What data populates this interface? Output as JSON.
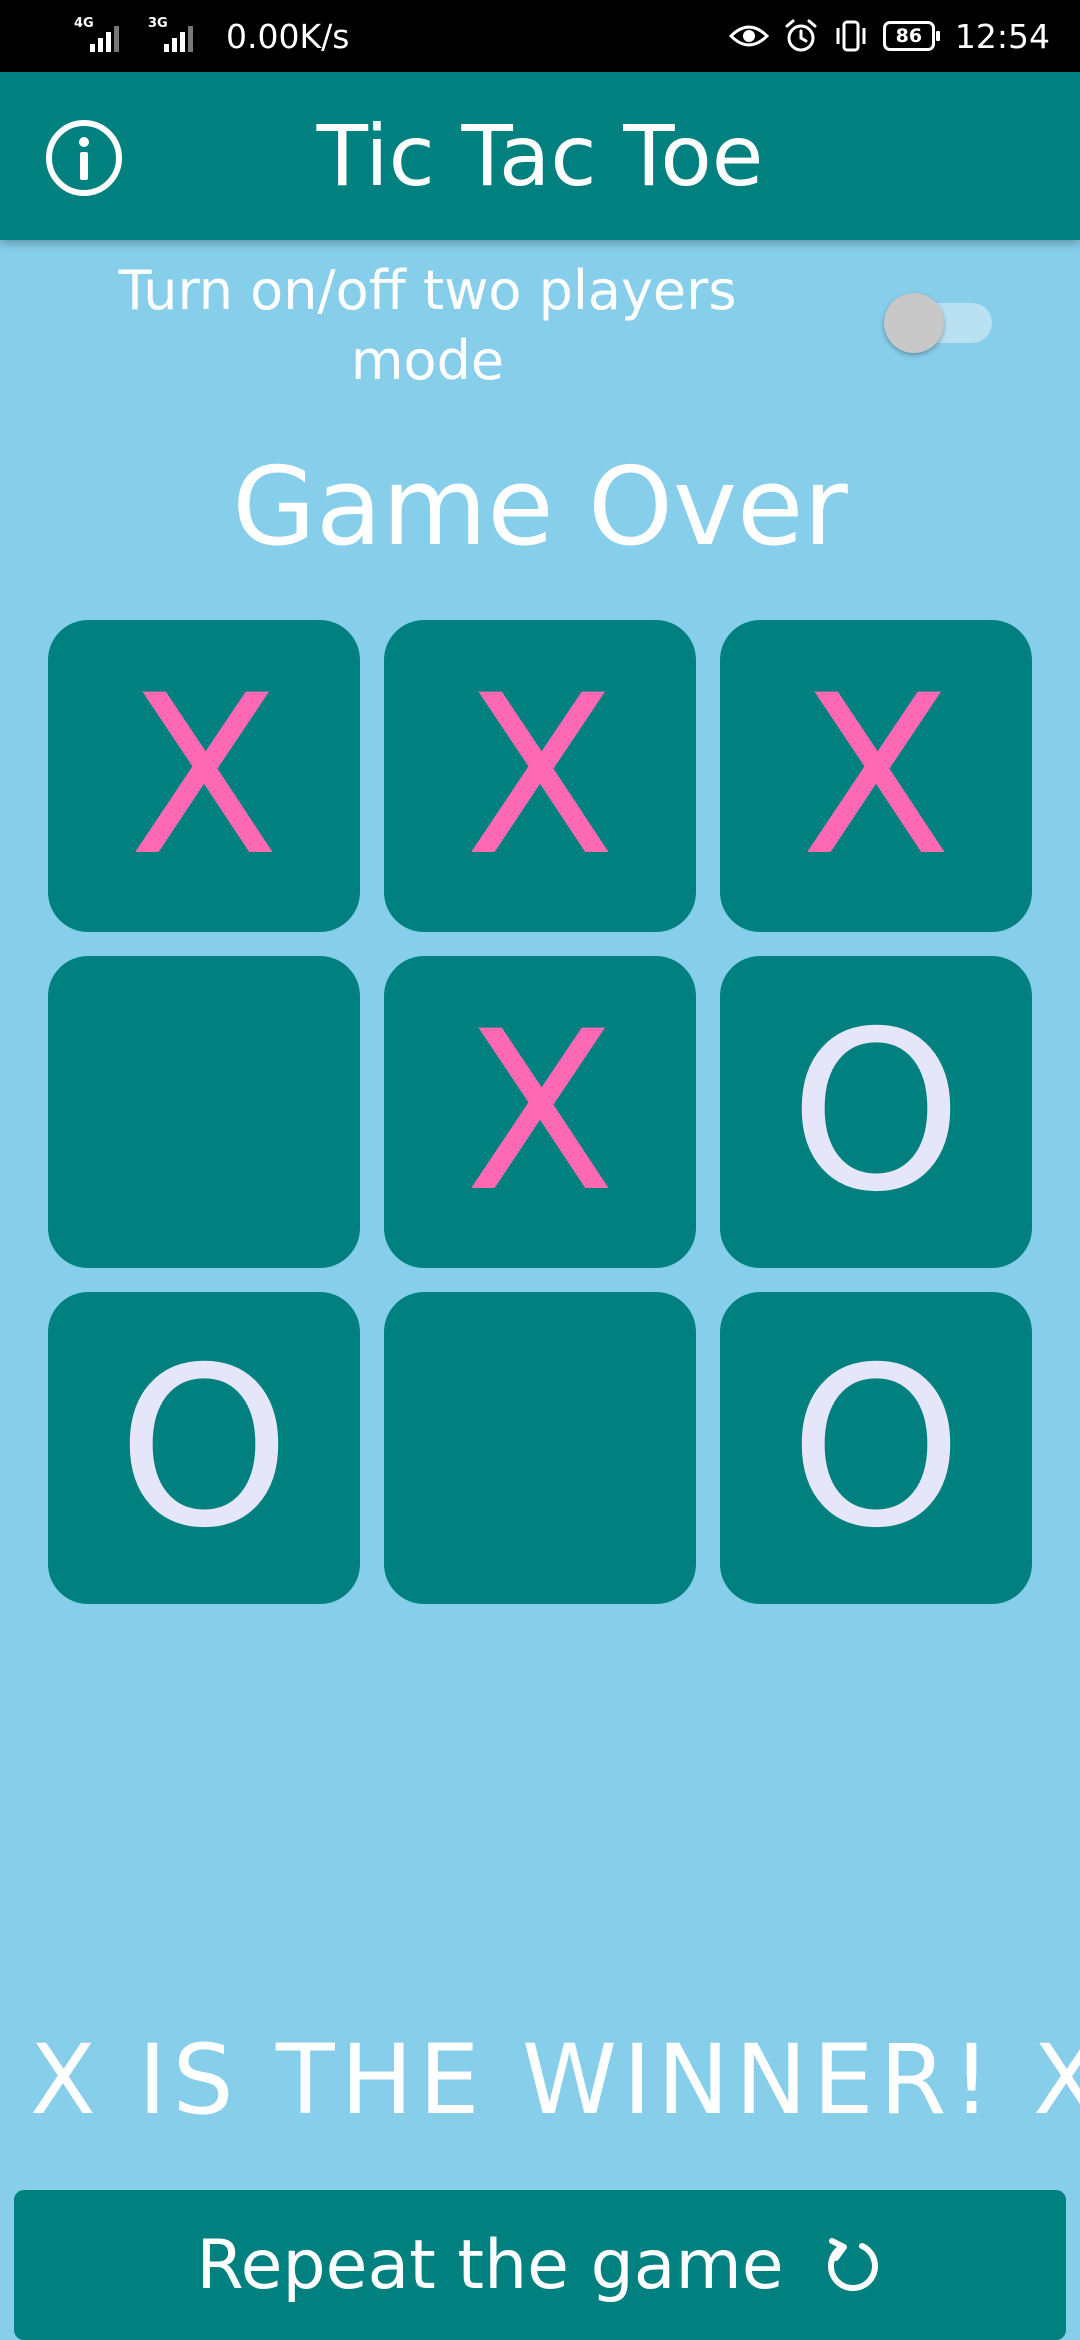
{
  "status_bar": {
    "network_1": "4G",
    "network_2": "3G",
    "net_speed": "0.00K/s",
    "icons": [
      "eye-icon",
      "alarm-icon",
      "vibrate-icon",
      "battery-icon"
    ],
    "battery_level": "86",
    "time": "12:54"
  },
  "app_bar": {
    "title": "Tic Tac Toe",
    "info_icon": "info-icon"
  },
  "settings": {
    "two_player_label": "Turn on/off two players mode",
    "two_player_enabled": false
  },
  "game": {
    "status": "Game Over",
    "board": [
      [
        "X",
        "X",
        "X"
      ],
      [
        "",
        "X",
        "O"
      ],
      [
        "O",
        "",
        "O"
      ]
    ],
    "winner_message": "X IS THE WINNER! X IS THE WINNER!"
  },
  "actions": {
    "repeat_label": "Repeat the game",
    "repeat_icon": "refresh-icon"
  },
  "colors": {
    "background": "#87CEEB",
    "primary": "#018080",
    "x_color": "#FF69B4",
    "o_color": "#E6E6FA",
    "text": "#FFFFFF"
  }
}
